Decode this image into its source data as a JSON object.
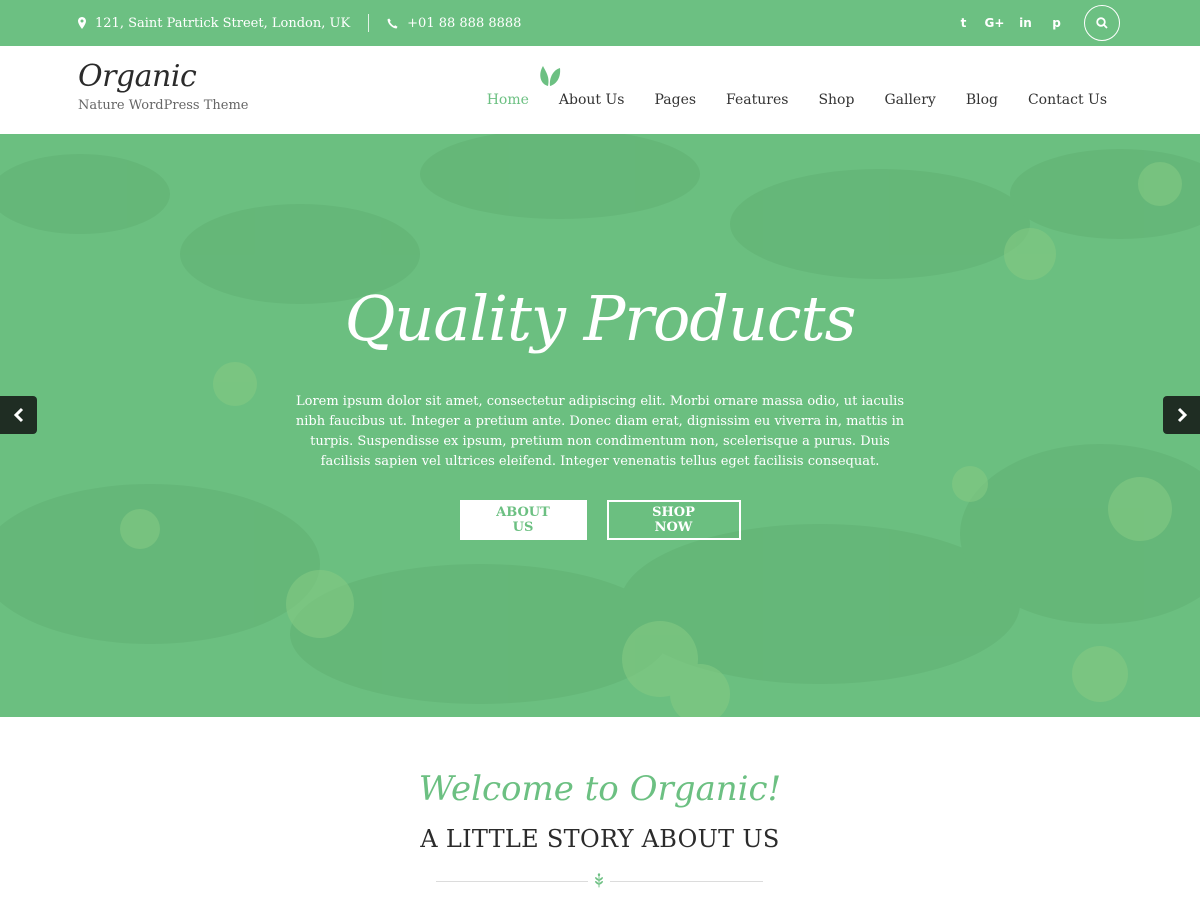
{
  "topbar": {
    "address": "121, Saint Patrtick Street, London, UK",
    "phone": "+01 88 888 8888",
    "social": [
      {
        "icon": "twitter-icon",
        "glyph": "t"
      },
      {
        "icon": "google-plus-icon",
        "glyph": "G+"
      },
      {
        "icon": "linkedin-icon",
        "glyph": "in"
      },
      {
        "icon": "pinterest-icon",
        "glyph": "p"
      }
    ]
  },
  "header": {
    "logo": "Organic",
    "tagline": "Nature WordPress Theme",
    "nav": [
      "Home",
      "About Us",
      "Pages",
      "Features",
      "Shop",
      "Gallery",
      "Blog",
      "Contact Us"
    ],
    "active_nav": "Home"
  },
  "hero": {
    "title": "Quality Products",
    "text": "Lorem ipsum dolor sit amet, consectetur adipiscing elit. Morbi ornare massa odio, ut iaculis nibh faucibus ut. Integer a pretium ante. Donec diam erat, dignissim eu viverra in, mattis in turpis. Suspendisse ex ipsum, pretium non condimentum non, scelerisque a purus. Duis facilisis sapien vel ultrices eleifend. Integer venenatis tellus eget facilisis consequat.",
    "button_primary": "ABOUT US",
    "button_secondary": "SHOP NOW"
  },
  "welcome": {
    "script": "Welcome to Organic!",
    "heading": "A LITTLE STORY ABOUT US"
  },
  "colors": {
    "accent": "#6cc082",
    "arrow_bg": "#1f2d23",
    "text_dark": "#2b2b2b"
  }
}
